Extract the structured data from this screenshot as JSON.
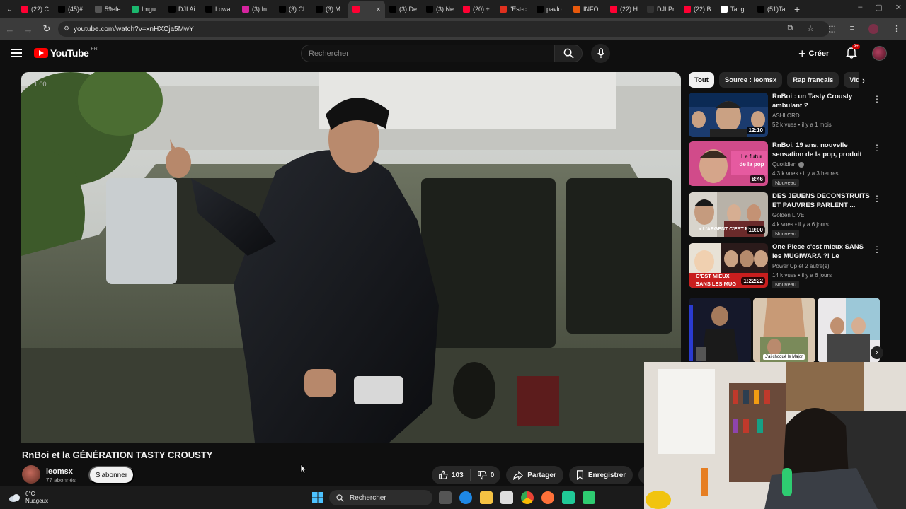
{
  "browser": {
    "tabs": [
      {
        "label": "(22) C",
        "color": "#ff0033",
        "icon": "youtube-icon"
      },
      {
        "label": "(45)#",
        "color": "#000000",
        "icon": "tiktok-icon"
      },
      {
        "label": "59efe",
        "color": "#555555",
        "icon": "globe-icon"
      },
      {
        "label": "Imgu",
        "color": "#1bb76e",
        "icon": "imgur-icon"
      },
      {
        "label": "DJI Ai",
        "color": "#000000",
        "icon": "x-icon"
      },
      {
        "label": "Lowa",
        "color": "#000000",
        "icon": "x-icon"
      },
      {
        "label": "(3) In",
        "color": "#d6249f",
        "icon": "instagram-icon"
      },
      {
        "label": "(3) Cl",
        "color": "#000000",
        "icon": "x-icon"
      },
      {
        "label": "(3) M",
        "color": "#000000",
        "icon": "x-icon"
      },
      {
        "label": "",
        "color": "#ff0033",
        "icon": "youtube-icon",
        "active": true
      },
      {
        "label": "(3) De",
        "color": "#000000",
        "icon": "x-icon"
      },
      {
        "label": "(3) Ne",
        "color": "#000000",
        "icon": "x-icon"
      },
      {
        "label": "(20) +",
        "color": "#ff0033",
        "icon": "youtube-icon"
      },
      {
        "label": "\"Est-c",
        "color": "#e0301e",
        "icon": "e-icon"
      },
      {
        "label": "pavlo",
        "color": "#000000",
        "icon": "x-icon"
      },
      {
        "label": "INFO",
        "color": "#e8590c",
        "icon": "rss-icon"
      },
      {
        "label": "(22) H",
        "color": "#ff0033",
        "icon": "youtube-icon"
      },
      {
        "label": "DJI Pr",
        "color": "#333333",
        "icon": "dji-icon"
      },
      {
        "label": "(22) B",
        "color": "#ff0033",
        "icon": "youtube-icon"
      },
      {
        "label": "Tang",
        "color": "#ffffff",
        "icon": "google-icon"
      },
      {
        "label": "(51)Ta",
        "color": "#000000",
        "icon": "tiktok-icon"
      }
    ],
    "url": "youtube.com/watch?v=xnHXCja5MwY"
  },
  "header": {
    "logo_text": "YouTube",
    "region": "FR",
    "search_placeholder": "Rechercher",
    "create_label": "Créer",
    "notif_count": "9+"
  },
  "player": {
    "timestamp": "1:00"
  },
  "video": {
    "title": "RnBoi et la GÉNÉRATION TASTY CROUSTY",
    "channel": "leomsx",
    "subscribers": "77 abonnés",
    "subscribe_label": "S'abonner",
    "likes": "103",
    "dislikes": "0",
    "share_label": "Partager",
    "save_label": "Enregistrer",
    "clip_label": "C"
  },
  "sidebar": {
    "chips": [
      "Tout",
      "Source : leomsx",
      "Rap français",
      "Vidé"
    ],
    "recommendations": [
      {
        "title": "RnBoi : un Tasty Crousty ambulant ?",
        "channel": "ASHLORD",
        "verified": false,
        "meta": "52 k vues • il y a 1 mois",
        "duration": "12:10",
        "new": false
      },
      {
        "title": "RnBoi, 19 ans, nouvelle sensation de la pop, produit pa...",
        "channel": "Quotidien",
        "verified": true,
        "meta": "4,3 k vues • il y a 3 heures",
        "duration": "8:46",
        "new": true
      },
      {
        "title": "DES JEUENS DECONSTRUITS ET PAUVRES PARLENT ...",
        "channel": "Golden LIVE",
        "verified": false,
        "meta": "4 k vues • il y a 6 jours",
        "duration": "19:00",
        "new": true
      },
      {
        "title": "One Piece c'est mieux SANS les MUGIWARA ?! Le MEILLEUR ar...",
        "channel": "Power Up et 2 autre(s)",
        "verified": false,
        "meta": "14 k vues • il y a 6 jours",
        "duration": "1:22:22",
        "new": true
      }
    ],
    "new_badge": "Nouveau",
    "thumb_captions": [
      "Le futur de la pop",
      "« L'ARGENT C'EST M",
      "C'EST MIEUX SANS LES MUG"
    ],
    "short_caption": "J'ai choqué le Major"
  },
  "taskbar": {
    "temperature": "6°C",
    "weather": "Nuageux",
    "search_label": "Rechercher"
  }
}
